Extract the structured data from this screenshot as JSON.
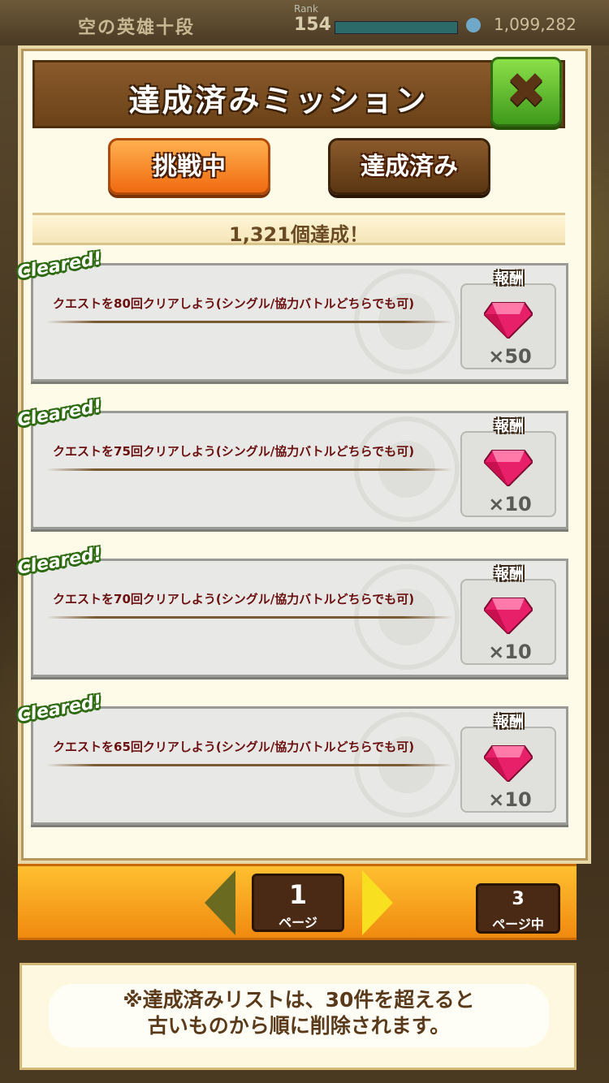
{
  "topbar": {
    "title": "空の英雄十段",
    "rank_label": "Rank",
    "rank_value": "154",
    "coins": "1,099,282"
  },
  "header": {
    "title": "達成済みミッション",
    "close_symbol": "✖"
  },
  "tabs": [
    {
      "label": "挑戦中",
      "active": false
    },
    {
      "label": "達成済み",
      "active": true
    }
  ],
  "summary": "1,321個達成！",
  "missions": [
    {
      "badge": "Cleared!",
      "text": "クエストを80回クリアしよう(シングル/協力バトルどちらでも可)",
      "reward_label": "報酬",
      "reward_icon": "gem-icon",
      "reward_count": "×50"
    },
    {
      "badge": "Cleared!",
      "text": "クエストを75回クリアしよう(シングル/協力バトルどちらでも可)",
      "reward_label": "報酬",
      "reward_icon": "gem-icon",
      "reward_count": "×10"
    },
    {
      "badge": "Cleared!",
      "text": "クエストを70回クリアしよう(シングル/協力バトルどちらでも可)",
      "reward_label": "報酬",
      "reward_icon": "gem-icon",
      "reward_count": "×10"
    },
    {
      "badge": "Cleared!",
      "text": "クエストを65回クリアしよう(シングル/協力バトルどちらでも可)",
      "reward_label": "報酬",
      "reward_icon": "gem-icon",
      "reward_count": "×10"
    }
  ],
  "pager": {
    "current_page": "1",
    "current_unit": "ページ",
    "total_pages": "3",
    "total_unit": "ページ中"
  },
  "note": {
    "line1": "※達成済みリストは、30件を超えると",
    "line2": "古いものから順に削除されます。"
  },
  "colors": {
    "gem": "#e8206a",
    "accent_orange": "#f08a10",
    "close_green": "#4caf28"
  }
}
